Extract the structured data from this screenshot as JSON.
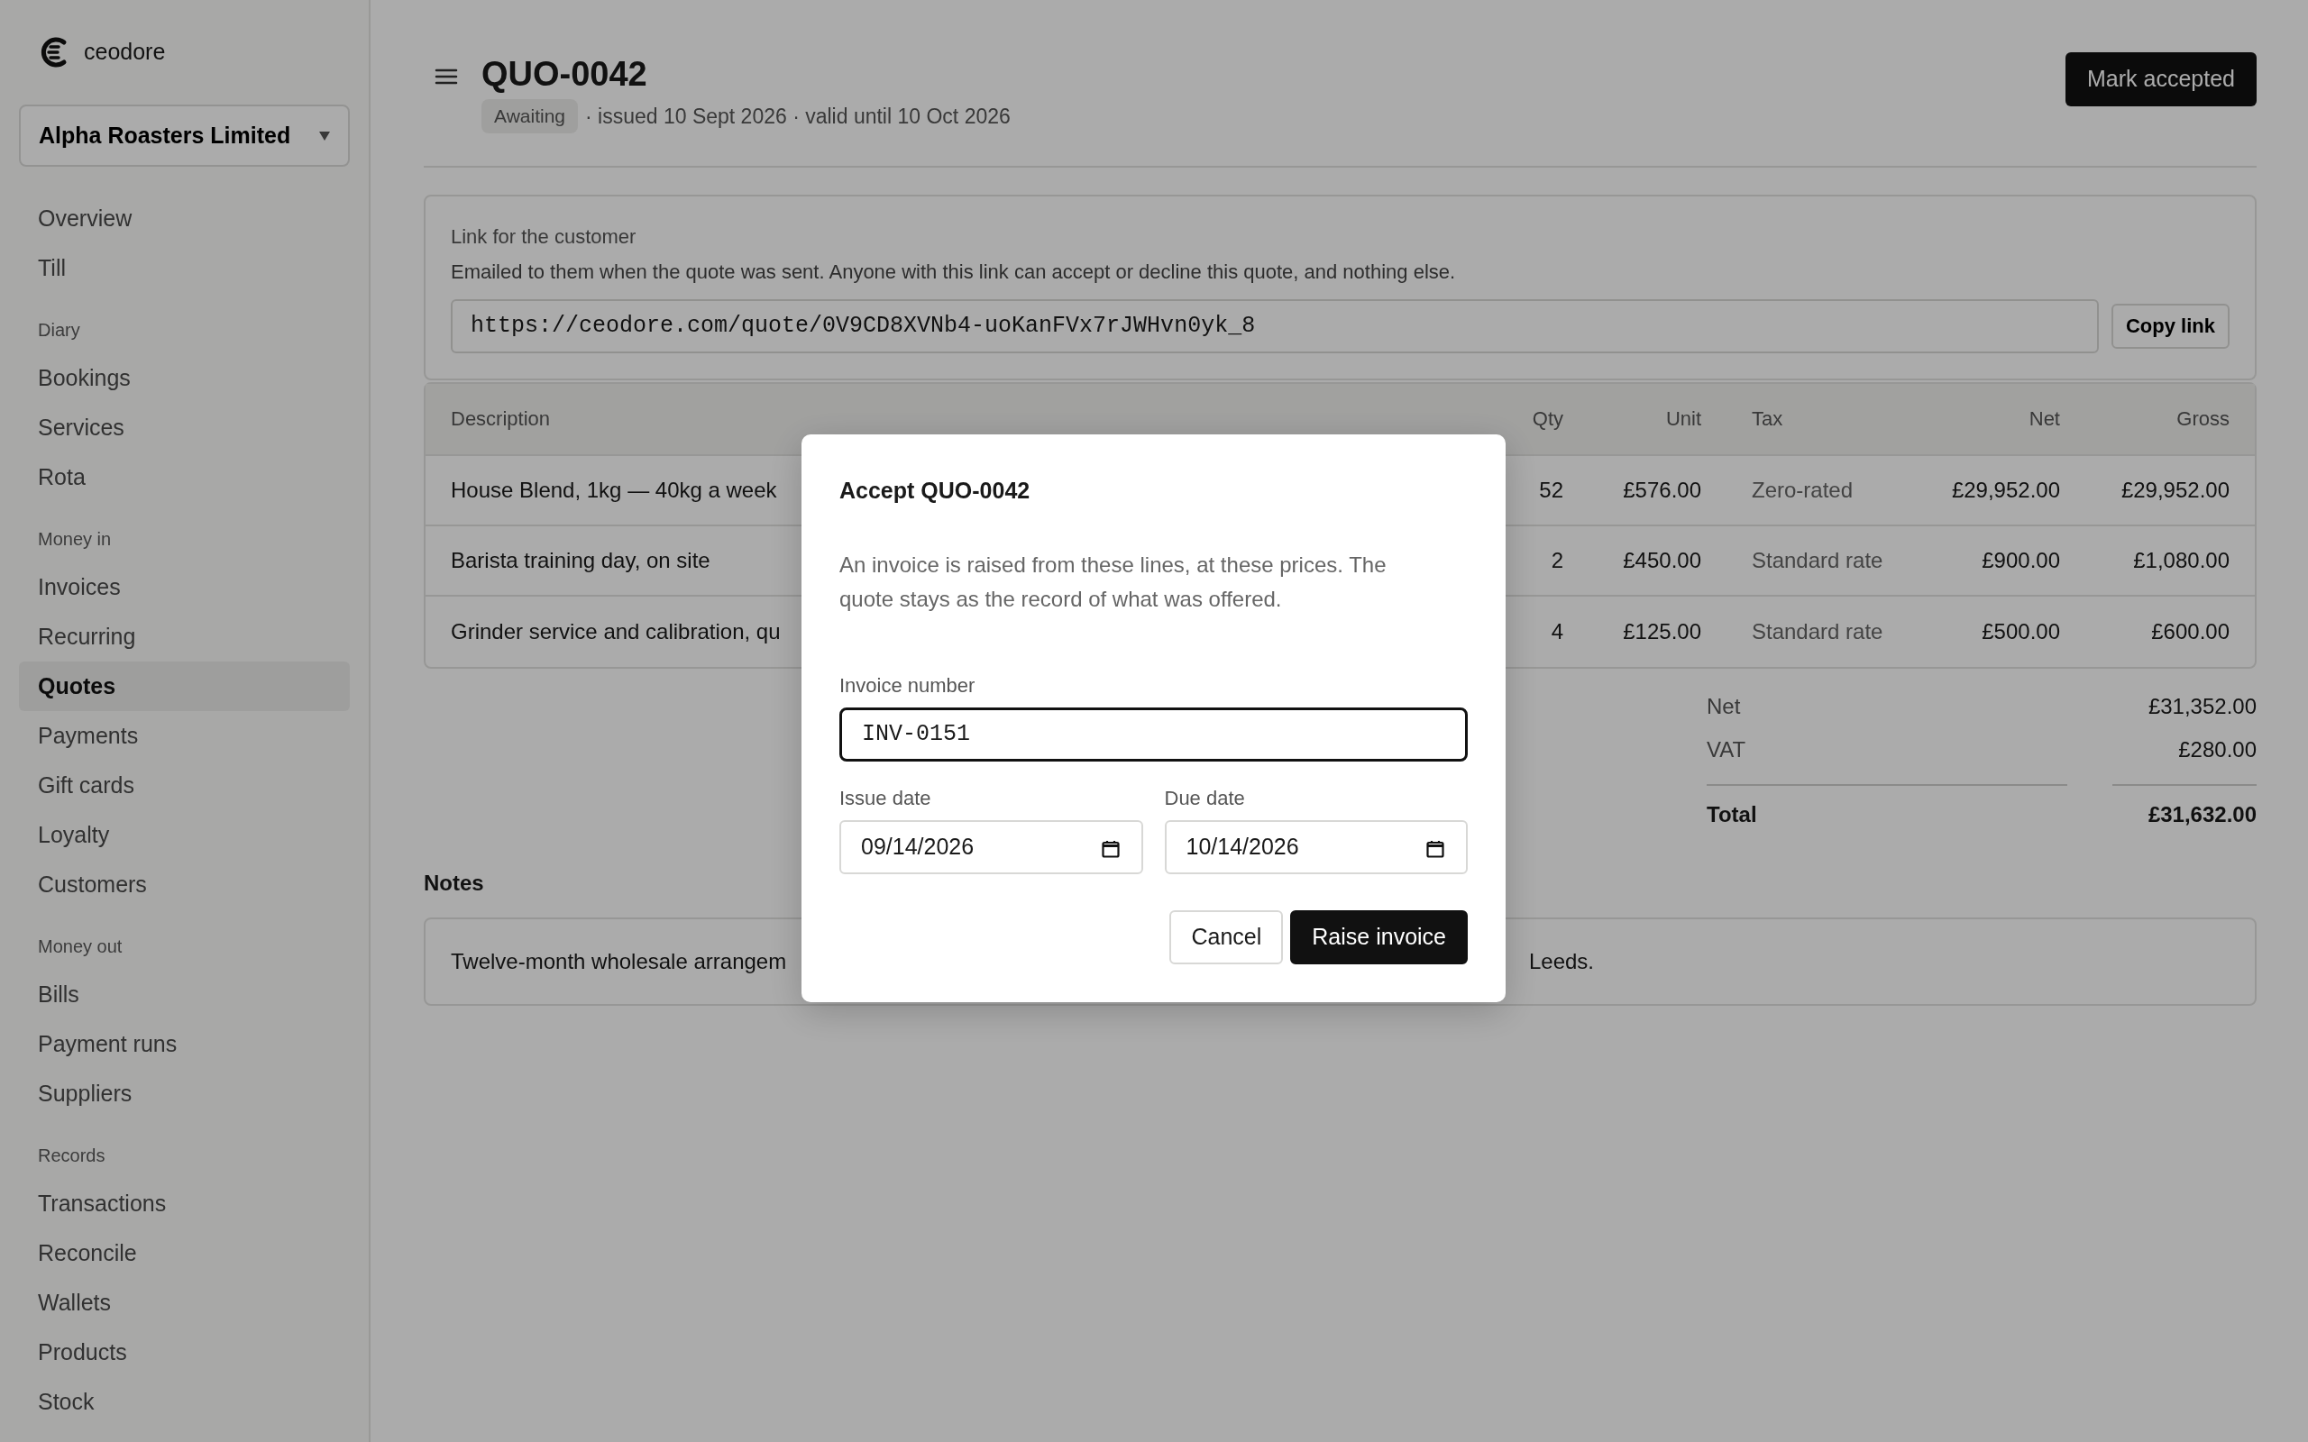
{
  "app": {
    "logo": "ceodore"
  },
  "org_select": {
    "value": "Alpha Roasters Limited"
  },
  "sidebar": {
    "items": [
      {
        "kind": "link",
        "label": "Overview",
        "selected": false
      },
      {
        "kind": "link",
        "label": "Till",
        "selected": false
      },
      {
        "kind": "heading",
        "label": "Diary"
      },
      {
        "kind": "link",
        "label": "Bookings",
        "selected": false
      },
      {
        "kind": "link",
        "label": "Services",
        "selected": false
      },
      {
        "kind": "link",
        "label": "Rota",
        "selected": false
      },
      {
        "kind": "heading",
        "label": "Money in"
      },
      {
        "kind": "link",
        "label": "Invoices",
        "selected": false
      },
      {
        "kind": "link",
        "label": "Recurring",
        "selected": false
      },
      {
        "kind": "link",
        "label": "Quotes",
        "selected": true
      },
      {
        "kind": "link",
        "label": "Payments",
        "selected": false
      },
      {
        "kind": "link",
        "label": "Gift cards",
        "selected": false
      },
      {
        "kind": "link",
        "label": "Loyalty",
        "selected": false
      },
      {
        "kind": "link",
        "label": "Customers",
        "selected": false
      },
      {
        "kind": "heading",
        "label": "Money out"
      },
      {
        "kind": "link",
        "label": "Bills",
        "selected": false
      },
      {
        "kind": "link",
        "label": "Payment runs",
        "selected": false
      },
      {
        "kind": "link",
        "label": "Suppliers",
        "selected": false
      },
      {
        "kind": "heading",
        "label": "Records"
      },
      {
        "kind": "link",
        "label": "Transactions",
        "selected": false
      },
      {
        "kind": "link",
        "label": "Reconcile",
        "selected": false
      },
      {
        "kind": "link",
        "label": "Wallets",
        "selected": false
      },
      {
        "kind": "link",
        "label": "Products",
        "selected": false
      },
      {
        "kind": "link",
        "label": "Stock",
        "selected": false
      }
    ]
  },
  "header": {
    "title": "QUO-0042",
    "status": "Awaiting",
    "meta": "· issued 10 Sept 2026 · valid until 10 Oct 2026",
    "action": "Mark accepted"
  },
  "link_card": {
    "title": "Link for the customer",
    "description": "Emailed to them when the quote was sent. Anyone with this link can accept or decline this quote, and nothing else.",
    "url": "https://ceodore.com/quote/0V9CD8XVNb4-uoKanFVx7rJWHvn0yk_8",
    "button": "Copy link"
  },
  "table": {
    "columns": [
      "Description",
      "Qty",
      "Unit",
      "Tax",
      "Net",
      "Gross"
    ],
    "rows": [
      [
        "House Blend, 1kg — 40kg a week",
        "52",
        "£576.00",
        "Zero-rated",
        "£29,952.00",
        "£29,952.00"
      ],
      [
        "Barista training day, on site",
        "2",
        "£450.00",
        "Standard rate",
        "£900.00",
        "£1,080.00"
      ],
      [
        "Grinder service and calibration, qu",
        "4",
        "£125.00",
        "Standard rate",
        "£500.00",
        "£600.00"
      ]
    ]
  },
  "totals": [
    {
      "kind": "subtotal",
      "label": "Net",
      "value": "£31,352.00"
    },
    {
      "kind": "subtotal",
      "label": "VAT",
      "value": "£280.00"
    },
    {
      "kind": "total",
      "label": "Total",
      "value": "£31,632.00"
    }
  ],
  "notes": {
    "heading": "Notes",
    "text_start": "Twelve-month wholesale arrangem",
    "text_end": "Leeds."
  },
  "dialog": {
    "title": "Accept QUO-0042",
    "message": "An invoice is raised from these lines, at these prices. The quote stays as the record of what was offered.",
    "fields": [
      {
        "kind": "text",
        "label": "Invoice number",
        "value": "INV-0151",
        "focused": true
      },
      {
        "kind": "date",
        "label": "Issue date",
        "value": "09/14/2026",
        "focused": false
      },
      {
        "kind": "date",
        "label": "Due date",
        "value": "10/14/2026",
        "focused": false
      }
    ],
    "buttons": [
      {
        "kind": "secondary",
        "label": "Cancel"
      },
      {
        "kind": "primary",
        "label": "Raise invoice"
      }
    ]
  }
}
